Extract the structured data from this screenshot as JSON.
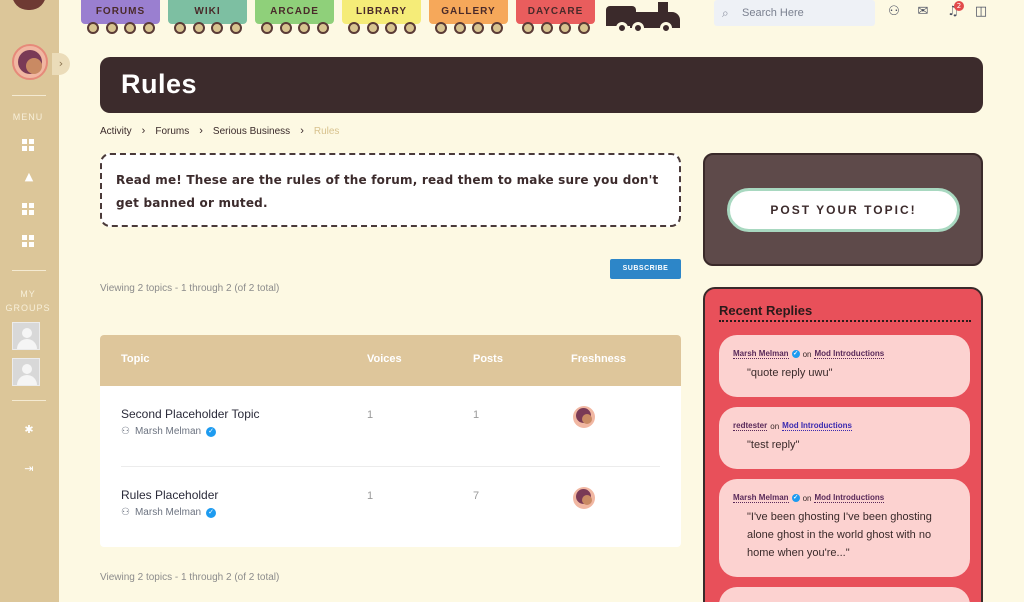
{
  "nav": {
    "tabs": [
      {
        "label": "FORUMS",
        "color": "#9a7fd0"
      },
      {
        "label": "WIKI",
        "color": "#7dbfa2"
      },
      {
        "label": "ARCADE",
        "color": "#8fd07a"
      },
      {
        "label": "LIBRARY",
        "color": "#f5ec78"
      },
      {
        "label": "GALLERY",
        "color": "#f6a85a"
      },
      {
        "label": "DAYCARE",
        "color": "#e95d5d"
      }
    ],
    "search_placeholder": "Search Here",
    "notification_count": "2",
    "icons": [
      "friends-icon",
      "mail-icon",
      "bell-icon",
      "bag-icon"
    ]
  },
  "sidebar": {
    "menu_label": "MENU",
    "groups_label_1": "MY",
    "groups_label_2": "GROUPS",
    "toggle": "›"
  },
  "page": {
    "title": "Rules",
    "breadcrumb": [
      "Activity",
      "Forums",
      "Serious Business",
      "Rules"
    ],
    "notice": "Read me! These are the rules of the forum, read them to make sure you don't get banned or muted.",
    "subscribe_label": "SUBSCRIBE",
    "viewing_top": "Viewing 2 topics - 1 through 2 (of 2 total)",
    "viewing_bottom": "Viewing 2 topics - 1 through 2 (of 2 total)"
  },
  "table": {
    "headers": {
      "topic": "Topic",
      "voices": "Voices",
      "posts": "Posts",
      "freshness": "Freshness"
    },
    "rows": [
      {
        "title": "Second Placeholder Topic",
        "author": "Marsh Melman",
        "voices": "1",
        "posts": "1"
      },
      {
        "title": "Rules Placeholder",
        "author": "Marsh Melman",
        "voices": "1",
        "posts": "7"
      }
    ]
  },
  "post_box": {
    "button_label": "POST YOUR TOPIC!"
  },
  "recent": {
    "title": "Recent Replies",
    "items": [
      {
        "user": "Marsh Melman",
        "on": "on",
        "topic": "Mod Introductions",
        "quote": "\"quote reply uwu\""
      },
      {
        "user": "redtester",
        "on": "on",
        "topic": "Mod Introductions",
        "quote": "\"test reply\""
      },
      {
        "user": "Marsh Melman",
        "on": "on",
        "topic": "Mod Introductions",
        "quote": "\"I've been ghosting I've been ghosting alone ghost in the world ghost with no home when you're...\""
      }
    ]
  }
}
